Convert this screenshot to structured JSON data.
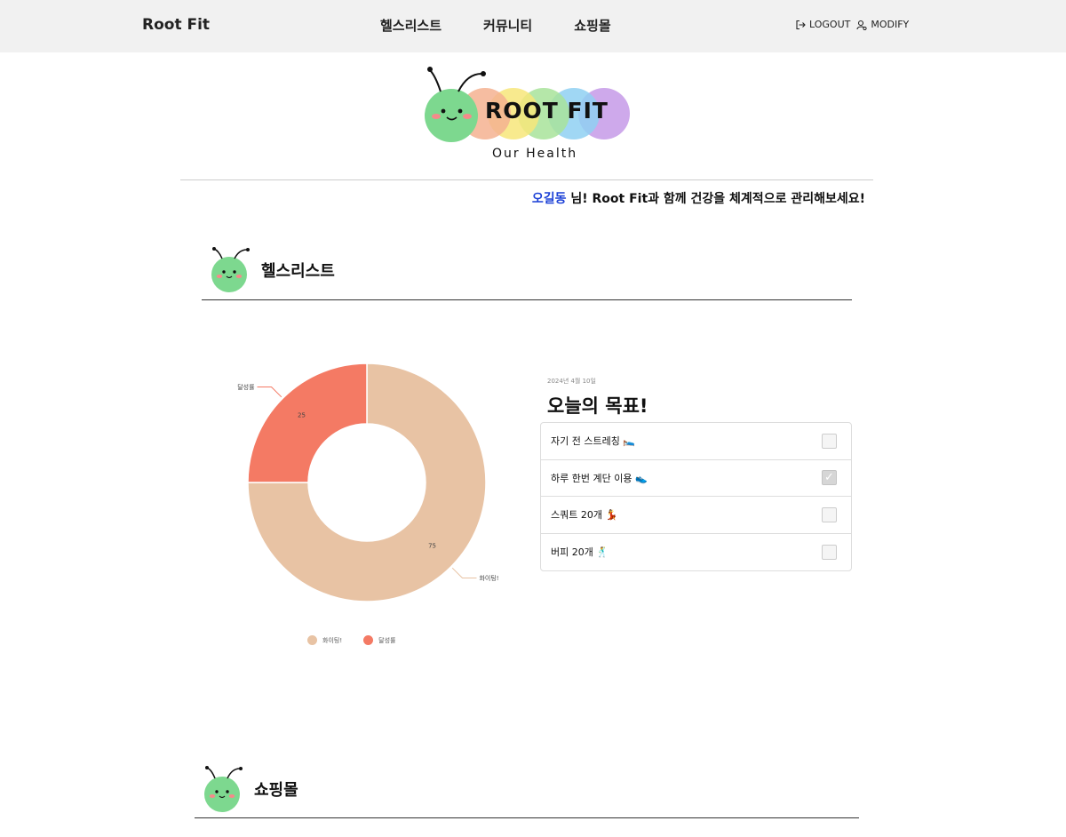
{
  "nav": {
    "brand": "Root Fit",
    "menu": [
      "헬스리스트",
      "커뮤니티",
      "쇼핑몰"
    ],
    "logout": "LOGOUT",
    "modify": "MODIFY"
  },
  "logo": {
    "title": "ROOT FIT",
    "subtitle": "Our Health"
  },
  "greeting": {
    "user": "오길동",
    "message": " 님! Root Fit과 함께 건강을 체계적으로 관리해보세요!"
  },
  "sections": {
    "healthlist": "헬스리스트",
    "shop": "쇼핑몰"
  },
  "chart_data": {
    "type": "pie",
    "donut": true,
    "categories": [
      "화이팅!",
      "달성률"
    ],
    "values": [
      75,
      25
    ],
    "colors": [
      "#e8c3a4",
      "#f47a64"
    ],
    "legend": "bottom"
  },
  "todo": {
    "date": "2024년 4월 10일",
    "title": "오늘의 목표!",
    "items": [
      {
        "label": "자기 전 스트레칭 🛌",
        "checked": false
      },
      {
        "label": "하루 한번 계단 이용 👟",
        "checked": true
      },
      {
        "label": "스쿼트 20개 💃",
        "checked": false
      },
      {
        "label": "버피 20개 🕺",
        "checked": false
      }
    ]
  }
}
